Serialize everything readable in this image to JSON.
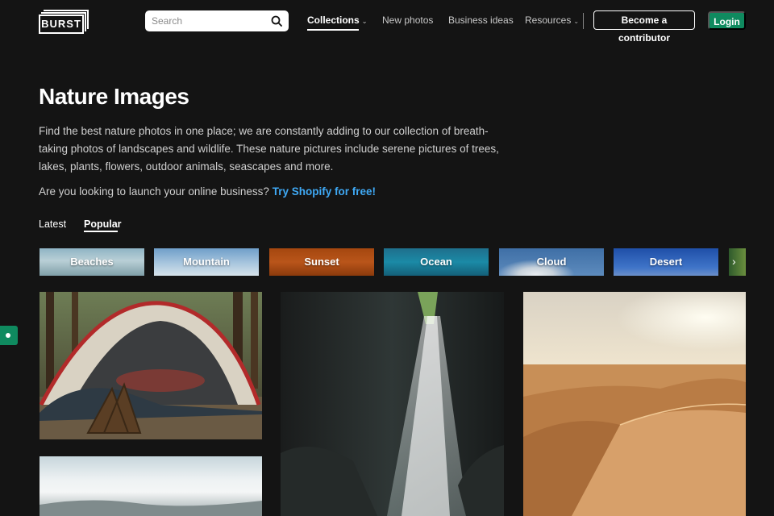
{
  "header": {
    "logo_text": "BURST",
    "search_placeholder": "Search",
    "nav": [
      {
        "label": "Collections",
        "has_dropdown": true,
        "active": true
      },
      {
        "label": "New photos",
        "has_dropdown": false,
        "active": false
      },
      {
        "label": "Business ideas",
        "has_dropdown": false,
        "active": false
      },
      {
        "label": "Resources",
        "has_dropdown": true,
        "active": false
      }
    ],
    "contributor_label": "Become a contributor",
    "login_label": "Login"
  },
  "hero": {
    "title": "Nature Images",
    "description": "Find the best nature photos in one place; we are constantly adding to our collection of breath-taking photos of landscapes and wildlife. These nature pictures include serene pictures of trees, lakes, plants, flowers, outdoor animals, seascapes and more.",
    "promo_text": "Are you looking to launch your online business?",
    "promo_link": "Try Shopify for free!"
  },
  "tabs": [
    {
      "label": "Latest",
      "active": false
    },
    {
      "label": "Popular",
      "active": true
    }
  ],
  "categories": [
    {
      "label": "Beaches"
    },
    {
      "label": "Mountain"
    },
    {
      "label": "Sunset"
    },
    {
      "label": "Ocean"
    },
    {
      "label": "Cloud"
    },
    {
      "label": "Desert"
    }
  ],
  "colors": {
    "background": "#141414",
    "accent_green": "#0f8a5f",
    "link_blue": "#3fa9f5"
  },
  "icons": {
    "search": "search-icon",
    "chevron": "chevron-down-icon",
    "next": "chevron-right-icon"
  }
}
